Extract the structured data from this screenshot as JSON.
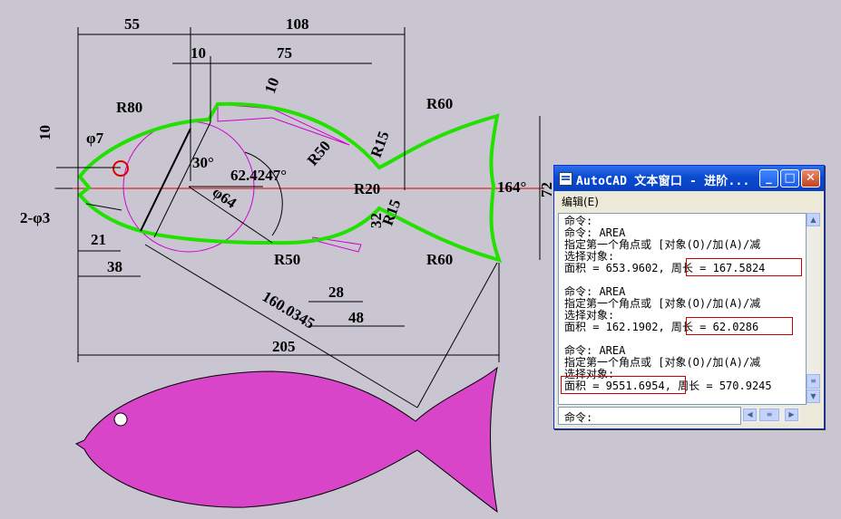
{
  "drawing": {
    "dimensions": {
      "d55": "55",
      "d108": "108",
      "d10_top": "10",
      "d75": "75",
      "d10_slant": "10",
      "r80": "R80",
      "r60_top": "R60",
      "r60_bottom": "R60",
      "phi7": "φ7",
      "d10_left": "10",
      "d2phi3": "2-φ3",
      "d30": "30°",
      "angle": "62.4247°",
      "phi64": "φ64",
      "r50_top": "R50",
      "r15_top": "R15",
      "r20": "R20",
      "d32": "32",
      "r15_bottom": "R15",
      "d164": "164°",
      "d72": "72",
      "d21": "21",
      "d38": "38",
      "r50_bottom": "R50",
      "d28": "28",
      "d48": "48",
      "d160": "160.0345",
      "d205": "205"
    },
    "colors": {
      "outline": "#22e000",
      "construction": "#d000d0",
      "centerline": "#e00000",
      "solid_fish": "#d845c8",
      "background": "#c9c6d1"
    }
  },
  "window": {
    "title": "AutoCAD 文本窗口 - 进阶...",
    "menu": "编辑(E)",
    "buttons": {
      "minimize": "_",
      "maximize": "□",
      "close": "✕"
    },
    "lines": [
      "命令:",
      "命令:  AREA",
      "指定第一个角点或 [对象(O)/加(A)/减",
      "选择对象:",
      "面积 = 653.9602,  周长 = 167.5824",
      "",
      "命令:  AREA",
      "指定第一个角点或 [对象(O)/加(A)/减",
      "选择对象:",
      "面积 = 162.1902,  周长 = 62.0286",
      "",
      "命令:  AREA",
      "指定第一个角点或 [对象(O)/加(A)/减",
      "选择对象:",
      "面积 = 9551.6954,  周长 = 570.9245"
    ],
    "command_prompt": "命令:"
  }
}
